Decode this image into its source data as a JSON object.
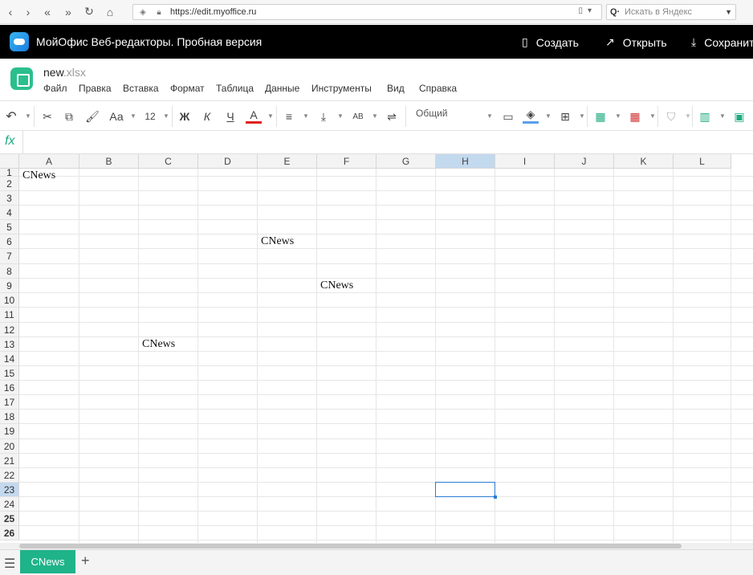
{
  "browser": {
    "url": "https://edit.myoffice.ru",
    "search_placeholder": "Искать в Яндекс",
    "search_engine_icon": "Я"
  },
  "app": {
    "title": "МойОфис Веб-редакторы. Пробная версия",
    "create_label": "Создать",
    "open_label": "Открыть",
    "save_label": "Сохранит"
  },
  "doc": {
    "name": "new",
    "ext": ".xlsx",
    "menu": [
      "Файл",
      "Правка",
      "Вставка",
      "Формат",
      "Таблица",
      "Данные",
      "Инструменты",
      "Вид",
      "Справка"
    ]
  },
  "toolbar": {
    "font_size": "12",
    "bold": "Ж",
    "italic": "К",
    "underline": "Ч",
    "font_color": "А",
    "font_family_icon": "Аа",
    "wrap": "АВ",
    "number_format": "Общий",
    "font_color_hex": "#e02020",
    "fill_color_hex": "#5aa0e8"
  },
  "grid": {
    "columns": [
      "A",
      "B",
      "C",
      "D",
      "E",
      "F",
      "G",
      "H",
      "I",
      "J",
      "K",
      "L"
    ],
    "selected_column": "H",
    "rows": [
      "1",
      "2",
      "3",
      "4",
      "5",
      "6",
      "7",
      "8",
      "9",
      "10",
      "11",
      "12",
      "13",
      "14",
      "15",
      "16",
      "17",
      "18",
      "19",
      "20",
      "21",
      "22",
      "23",
      "24",
      "25",
      "26"
    ],
    "selected_row": "23",
    "cells": [
      {
        "ref": "A1",
        "value": "CNews"
      },
      {
        "ref": "E6",
        "value": "CNews"
      },
      {
        "ref": "F9",
        "value": "CNews"
      },
      {
        "ref": "C13",
        "value": "CNews"
      }
    ]
  },
  "sheets": {
    "active": "CNews"
  },
  "colors": {
    "accent": "#1fb38a",
    "selection": "#2a7bd4",
    "header_selected": "#c3d9ee"
  }
}
